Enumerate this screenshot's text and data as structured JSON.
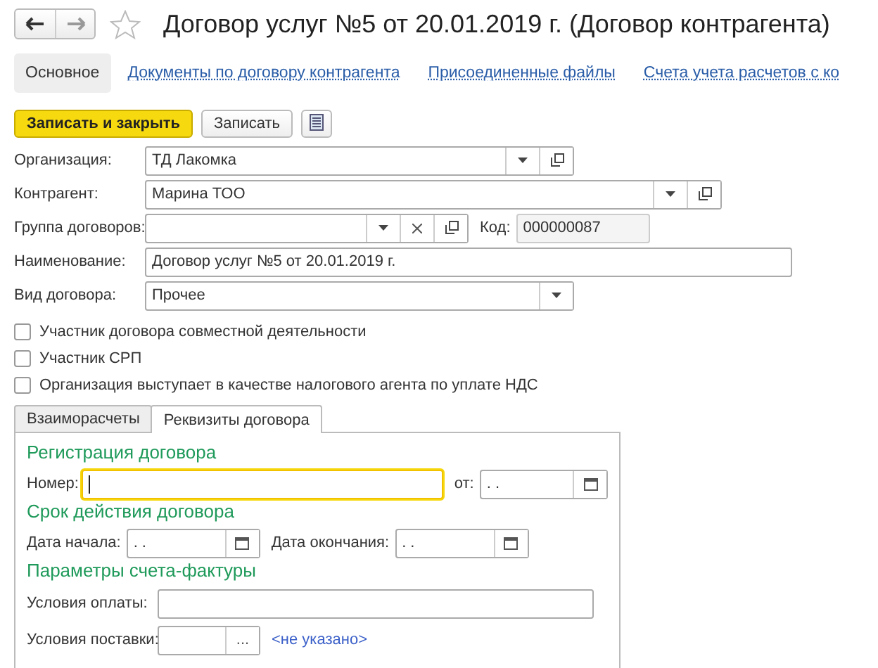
{
  "title": "Договор услуг №5 от 20.01.2019 г. (Договор контрагента)",
  "favorite": false,
  "sections": [
    {
      "label": "Основное",
      "selected": true
    },
    {
      "label": "Документы по договору контрагента",
      "selected": false
    },
    {
      "label": "Присоединенные файлы",
      "selected": false
    },
    {
      "label": "Счета учета расчетов с ко",
      "selected": false
    }
  ],
  "buttons": [
    {
      "label": "Записать и закрыть",
      "kind": "primary"
    },
    {
      "label": "Записать",
      "kind": "normal"
    }
  ],
  "fields": [
    {
      "label": "Организация:",
      "value": "ТД Лакомка",
      "kind": "choice"
    },
    {
      "label": "Контрагент:",
      "value": "Марина ТОО",
      "kind": "reference"
    },
    {
      "label": "Группа договоров:",
      "kind": "group",
      "code_label": "Код:",
      "code_value": "000000087"
    },
    {
      "label": "Наименование:",
      "value": "Договор услуг №5 от 20.01.2019 г.",
      "kind": "text"
    },
    {
      "label": "Вид договора:",
      "value": "Прочее",
      "kind": "list"
    }
  ],
  "checkboxes": [
    {
      "label": "Участник договора совместной деятельности",
      "checked": false
    },
    {
      "label": "Участник СРП",
      "checked": false
    },
    {
      "label": "Организация выступает в качестве налогового агента по уплате НДС",
      "checked": false
    }
  ],
  "tabs": [
    {
      "label": "Взаиморасчеты",
      "selected": false
    },
    {
      "label": "Реквизиты договора",
      "selected": true
    }
  ],
  "registration": {
    "heading": "Регистрация договора",
    "number_label": "Номер:",
    "number_focused": true,
    "date_label": "от:",
    "date_value": ". ."
  },
  "term": {
    "heading": "Срок действия договора",
    "start_label": "Дата начала:",
    "start_value": ". .",
    "end_label": "Дата окончания:",
    "end_value": ". ."
  },
  "invoice": {
    "heading": "Параметры счета-фактуры",
    "payment_label": "Условия оплаты:",
    "delivery_label": "Условия поставки:",
    "delivery_button": "...",
    "delivery_link": "<не указано>"
  }
}
